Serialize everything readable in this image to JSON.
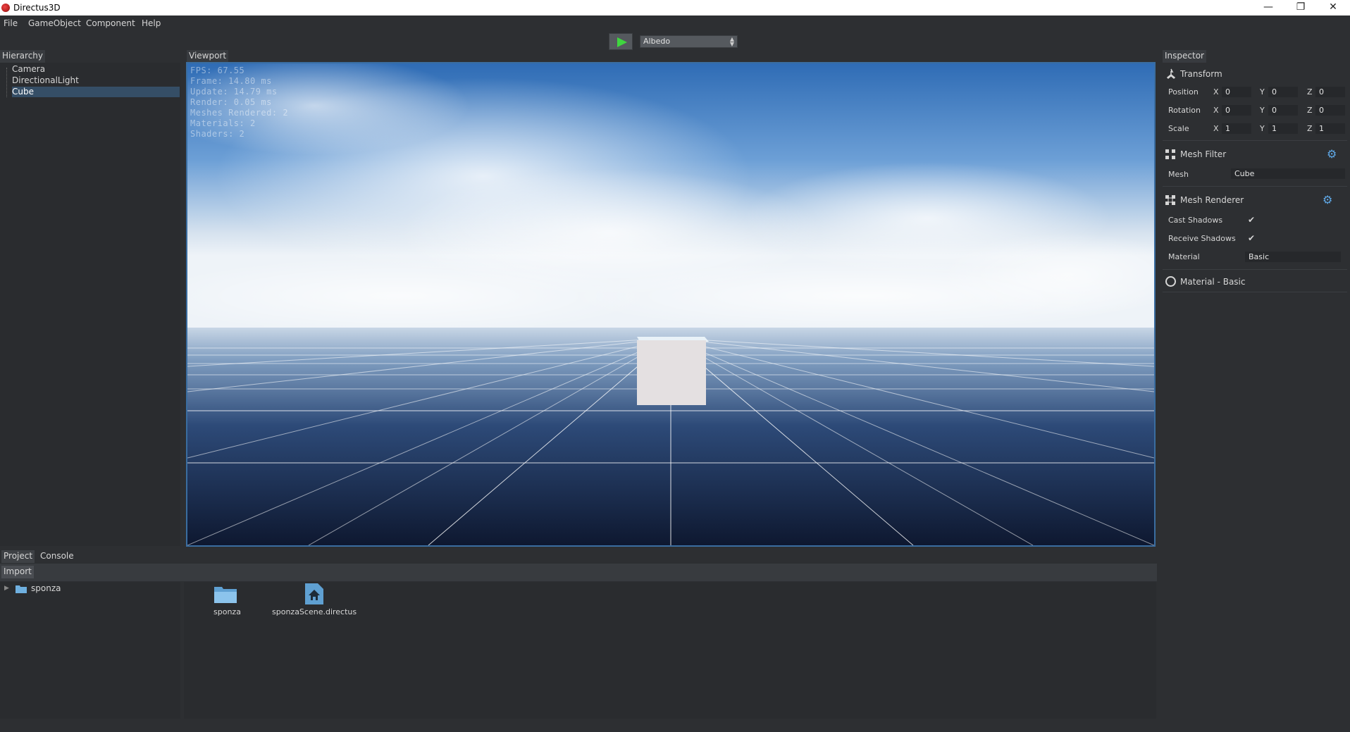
{
  "window": {
    "title": "Directus3D",
    "minimize": "—",
    "restore": "❐",
    "close": "✕"
  },
  "menu": [
    "File",
    "GameObject",
    "Component",
    "Help"
  ],
  "toolbar": {
    "render_mode": "Albedo"
  },
  "hierarchy": {
    "tab": "Hierarchy",
    "items": [
      "Camera",
      "DirectionalLight",
      "Cube"
    ],
    "selected": "Cube"
  },
  "viewport": {
    "tab": "Viewport",
    "stats": [
      "FPS: 67.55",
      "Frame: 14.80 ms",
      "Update: 14.79 ms",
      "Render: 0.05 ms",
      "Meshes Rendered: 2",
      "Materials: 2",
      "Shaders: 2"
    ]
  },
  "inspector": {
    "tab": "Inspector",
    "transform": {
      "title": "Transform",
      "rows": [
        {
          "label": "Position",
          "x": "0",
          "y": "0",
          "z": "0"
        },
        {
          "label": "Rotation",
          "x": "0",
          "y": "0",
          "z": "0"
        },
        {
          "label": "Scale",
          "x": "1",
          "y": "1",
          "z": "1"
        }
      ],
      "axis_x": "X",
      "axis_y": "Y",
      "axis_z": "Z"
    },
    "mesh_filter": {
      "title": "Mesh Filter",
      "mesh_label": "Mesh",
      "mesh_value": "Cube"
    },
    "mesh_renderer": {
      "title": "Mesh Renderer",
      "cast_shadows_label": "Cast Shadows",
      "cast_shadows": true,
      "receive_shadows_label": "Receive Shadows",
      "receive_shadows": true,
      "material_label": "Material",
      "material_value": "Basic"
    },
    "material": {
      "title": "Material - Basic"
    }
  },
  "bottom": {
    "tabs": [
      "Project",
      "Console"
    ],
    "import_button": "Import",
    "tree": [
      "sponza"
    ],
    "assets": [
      {
        "name": "sponza",
        "icon": "folder-icon"
      },
      {
        "name": "sponzaScene.directus",
        "icon": "scene-file-icon"
      }
    ]
  }
}
